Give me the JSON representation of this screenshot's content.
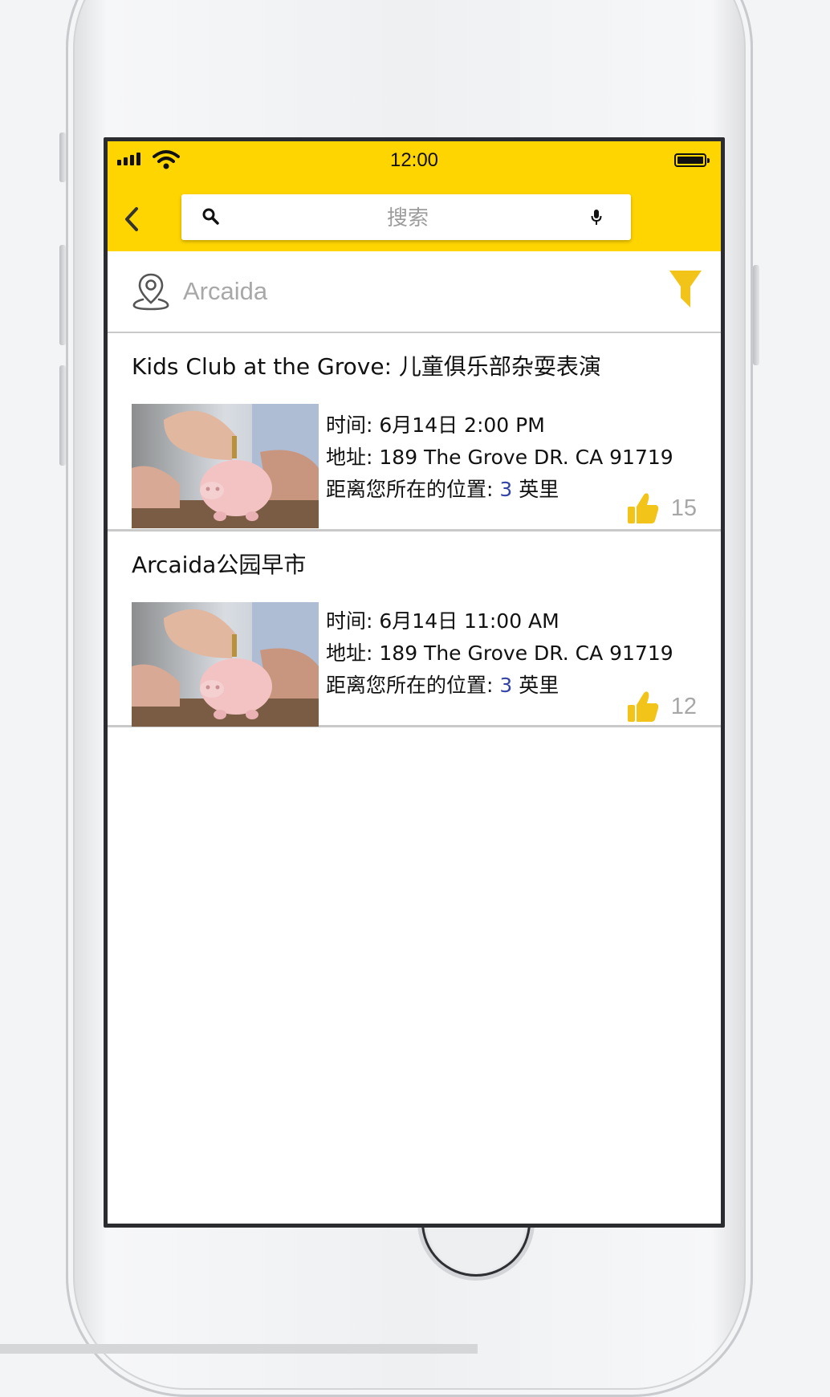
{
  "status_bar": {
    "time": "12:00"
  },
  "search": {
    "placeholder": "搜索"
  },
  "location": {
    "name": "Arcaida"
  },
  "events": [
    {
      "title": "Kids Club at the Grove: 儿童俱乐部杂耍表演",
      "time_label": "时间:",
      "time_value": "6月14日  2:00 PM",
      "address_label": "地址:",
      "address_value": "189 The Grove DR. CA 91719",
      "distance_label": "距离您所在的位置:",
      "distance_value": "3",
      "distance_unit": "英里",
      "likes": "15"
    },
    {
      "title": "Arcaida公园早市",
      "time_label": "时间:",
      "time_value": "6月14日  11:00 AM",
      "address_label": "地址:",
      "address_value": "189 The Grove DR. CA 91719",
      "distance_label": "距离您所在的位置:",
      "distance_value": "3",
      "distance_unit": "英里",
      "likes": "12"
    }
  ],
  "colors": {
    "accent_yellow": "#ffd500",
    "thumb_yellow": "#f5cc1f",
    "distance_number": "#3343a8",
    "muted_text": "#a8a8a8"
  },
  "icons": [
    "signal-icon",
    "wifi-icon",
    "battery-icon",
    "back-arrow-icon",
    "search-icon",
    "mic-icon",
    "location-pin-icon",
    "filter-icon",
    "thumbs-up-icon"
  ]
}
